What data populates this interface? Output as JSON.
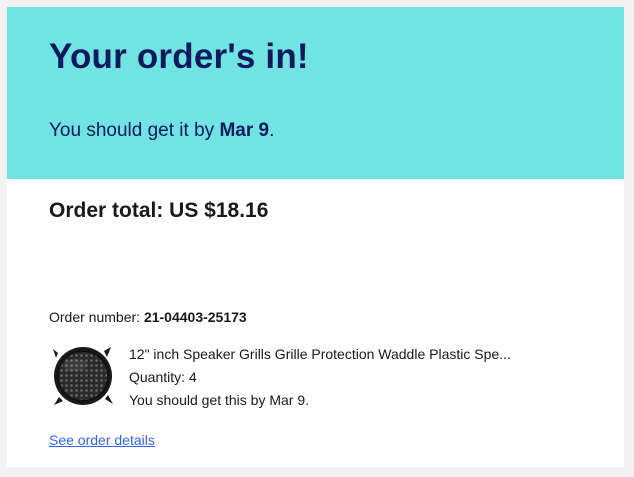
{
  "hero": {
    "heading": "Your order's in!",
    "eta_prefix": "You should get it by ",
    "eta_date": "Mar 9",
    "eta_suffix": "."
  },
  "order": {
    "total_label": "Order total: US $18.16",
    "number_label": "Order number:",
    "number_value": "21-04403-25173"
  },
  "item": {
    "title": "12\" inch Speaker Grills Grille Protection Waddle Plastic Spe...",
    "quantity": "Quantity: 4",
    "eta": "You should get this by Mar 9.",
    "thumbnail_icon": "speaker-grill-icon"
  },
  "links": {
    "details": "See order details"
  },
  "colors": {
    "hero_bg": "#71e3e2",
    "hero_text": "#0e1a5c",
    "link": "#3665f3"
  }
}
